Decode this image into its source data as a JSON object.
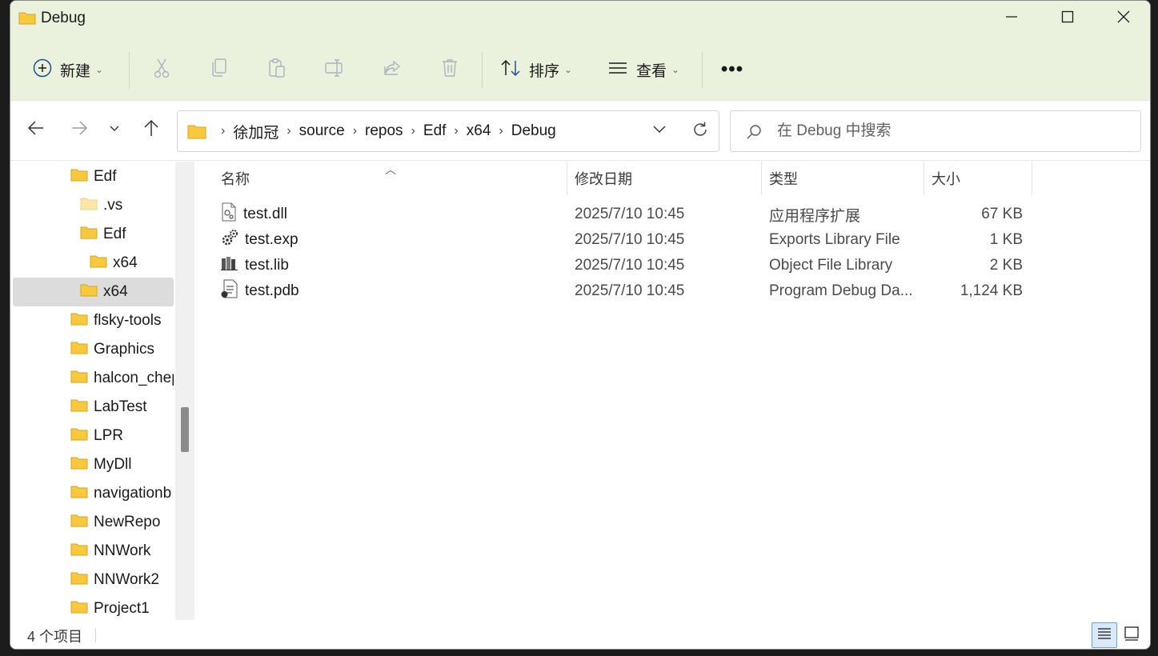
{
  "window": {
    "title": "Debug",
    "controls": {
      "minimize": "minimize-icon",
      "maximize": "maximize-icon",
      "close": "close-icon"
    }
  },
  "toolbar": {
    "new_label": "新建",
    "sort_label": "排序",
    "view_label": "查看",
    "more_label": "•••",
    "tools": [
      "cut-icon",
      "copy-icon",
      "paste-icon",
      "rename-icon",
      "share-icon",
      "delete-icon"
    ]
  },
  "address": {
    "breadcrumbs": [
      "徐加冠",
      "source",
      "repos",
      "Edf",
      "x64",
      "Debug"
    ]
  },
  "search": {
    "placeholder": "在 Debug 中搜索"
  },
  "sidebar": {
    "items": [
      {
        "label": "Edf",
        "indent": 1,
        "selected": false,
        "pale": false
      },
      {
        "label": ".vs",
        "indent": 2,
        "selected": false,
        "pale": true
      },
      {
        "label": "Edf",
        "indent": 2,
        "selected": false,
        "pale": false
      },
      {
        "label": "x64",
        "indent": 3,
        "selected": false,
        "pale": false
      },
      {
        "label": "x64",
        "indent": 2,
        "selected": true,
        "pale": false
      },
      {
        "label": "flsky-tools",
        "indent": 1,
        "selected": false,
        "pale": false
      },
      {
        "label": "Graphics",
        "indent": 1,
        "selected": false,
        "pale": false
      },
      {
        "label": "halcon_chep",
        "indent": 1,
        "selected": false,
        "pale": false
      },
      {
        "label": "LabTest",
        "indent": 1,
        "selected": false,
        "pale": false
      },
      {
        "label": "LPR",
        "indent": 1,
        "selected": false,
        "pale": false
      },
      {
        "label": "MyDll",
        "indent": 1,
        "selected": false,
        "pale": false
      },
      {
        "label": "navigationb",
        "indent": 1,
        "selected": false,
        "pale": false
      },
      {
        "label": "NewRepo",
        "indent": 1,
        "selected": false,
        "pale": false
      },
      {
        "label": "NNWork",
        "indent": 1,
        "selected": false,
        "pale": false
      },
      {
        "label": "NNWork2",
        "indent": 1,
        "selected": false,
        "pale": false
      },
      {
        "label": "Project1",
        "indent": 1,
        "selected": false,
        "pale": false
      }
    ]
  },
  "columns": {
    "name": "名称",
    "date": "修改日期",
    "type": "类型",
    "size": "大小"
  },
  "files": [
    {
      "name": "test.dll",
      "date": "2025/7/10 10:45",
      "type": "应用程序扩展",
      "size": "67 KB",
      "icon": "dll-file-icon"
    },
    {
      "name": "test.exp",
      "date": "2025/7/10 10:45",
      "type": "Exports Library File",
      "size": "1 KB",
      "icon": "exp-file-icon"
    },
    {
      "name": "test.lib",
      "date": "2025/7/10 10:45",
      "type": "Object File Library",
      "size": "2 KB",
      "icon": "lib-file-icon"
    },
    {
      "name": "test.pdb",
      "date": "2025/7/10 10:45",
      "type": "Program Debug Da...",
      "size": "1,124 KB",
      "icon": "pdb-file-icon"
    }
  ],
  "status": {
    "item_count": "4 个项目"
  },
  "colors": {
    "chrome_bg": "#eaf2de",
    "folder": "#f8c93e",
    "selected_bg": "#dcdcdc",
    "accent": "#6aa0d8"
  }
}
